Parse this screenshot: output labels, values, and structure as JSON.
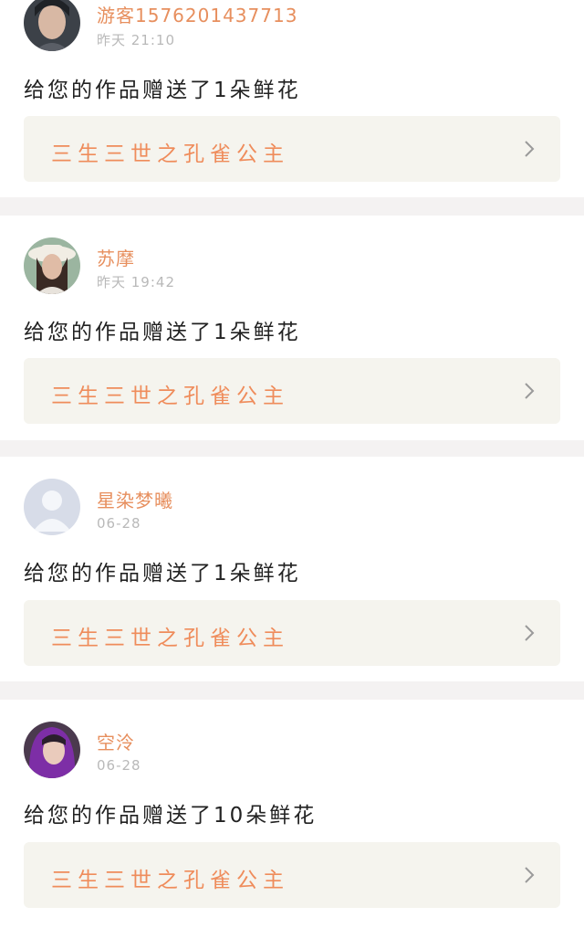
{
  "notifications": [
    {
      "username": "游客15762014377​13",
      "time": "昨天 21:10",
      "message": "给您的作品赠送了1朵鲜花",
      "work_title": "三生三世之孔雀公主",
      "avatar": "avatar-photo-woman-1"
    },
    {
      "username": "苏摩",
      "time": "昨天 19:42",
      "message": "给您的作品赠送了1朵鲜花",
      "work_title": "三生三世之孔雀公主",
      "avatar": "avatar-photo-woman-hat"
    },
    {
      "username": "星染梦曦",
      "time": "06-28",
      "message": "给您的作品赠送了1朵鲜花",
      "work_title": "三生三世之孔雀公主",
      "avatar": "default-avatar-icon"
    },
    {
      "username": "空泠",
      "time": "06-28",
      "message": "给您的作品赠送了10朵鲜花",
      "work_title": "三生三世之孔雀公主",
      "avatar": "avatar-photo-purple-hood"
    }
  ],
  "colors": {
    "username": "#e78f5e",
    "time": "#b9b9b9",
    "message": "#222222",
    "work_title": "#ef8c5b",
    "work_bg": "#f5f4ee",
    "divider": "#f4f2f2"
  }
}
